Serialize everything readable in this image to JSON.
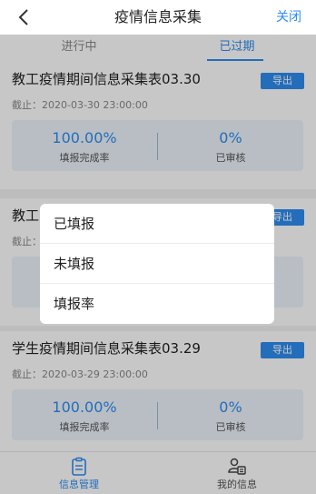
{
  "navbar": {
    "title": "疫情信息采集",
    "close_label": "关闭",
    "back_icon": "chevron-left-icon"
  },
  "tabs": [
    {
      "label": "进行中",
      "active": false
    },
    {
      "label": "已过期",
      "active": true
    }
  ],
  "cards": [
    {
      "title": "教工疫情期间信息采集表03.30",
      "export_label": "导出",
      "deadline": "截止：2020-03-30 23:00:00",
      "completion_rate": "100.00%",
      "completion_label": "填报完成率",
      "review_rate": "0%",
      "review_label": "已审核"
    },
    {
      "title": "教工",
      "export_label": "导出",
      "deadline": "截止：",
      "completion_rate": "",
      "completion_label": "",
      "review_rate": "",
      "review_label": ""
    },
    {
      "title": "学生疫情期间信息采集表03.29",
      "export_label": "导出",
      "deadline": "截止：2020-03-29 23:00:00",
      "completion_rate": "100.00%",
      "completion_label": "填报完成率",
      "review_rate": "0%",
      "review_label": "已审核"
    }
  ],
  "popup_menu": {
    "items": [
      "已填报",
      "未填报",
      "填报率"
    ]
  },
  "bottom_nav": [
    {
      "label": "信息管理",
      "icon": "clipboard-icon",
      "active": true
    },
    {
      "label": "我的信息",
      "icon": "user-card-icon",
      "active": false
    }
  ],
  "colors": {
    "accent": "#2d8cf0",
    "stats_bg": "#eef4fb"
  }
}
